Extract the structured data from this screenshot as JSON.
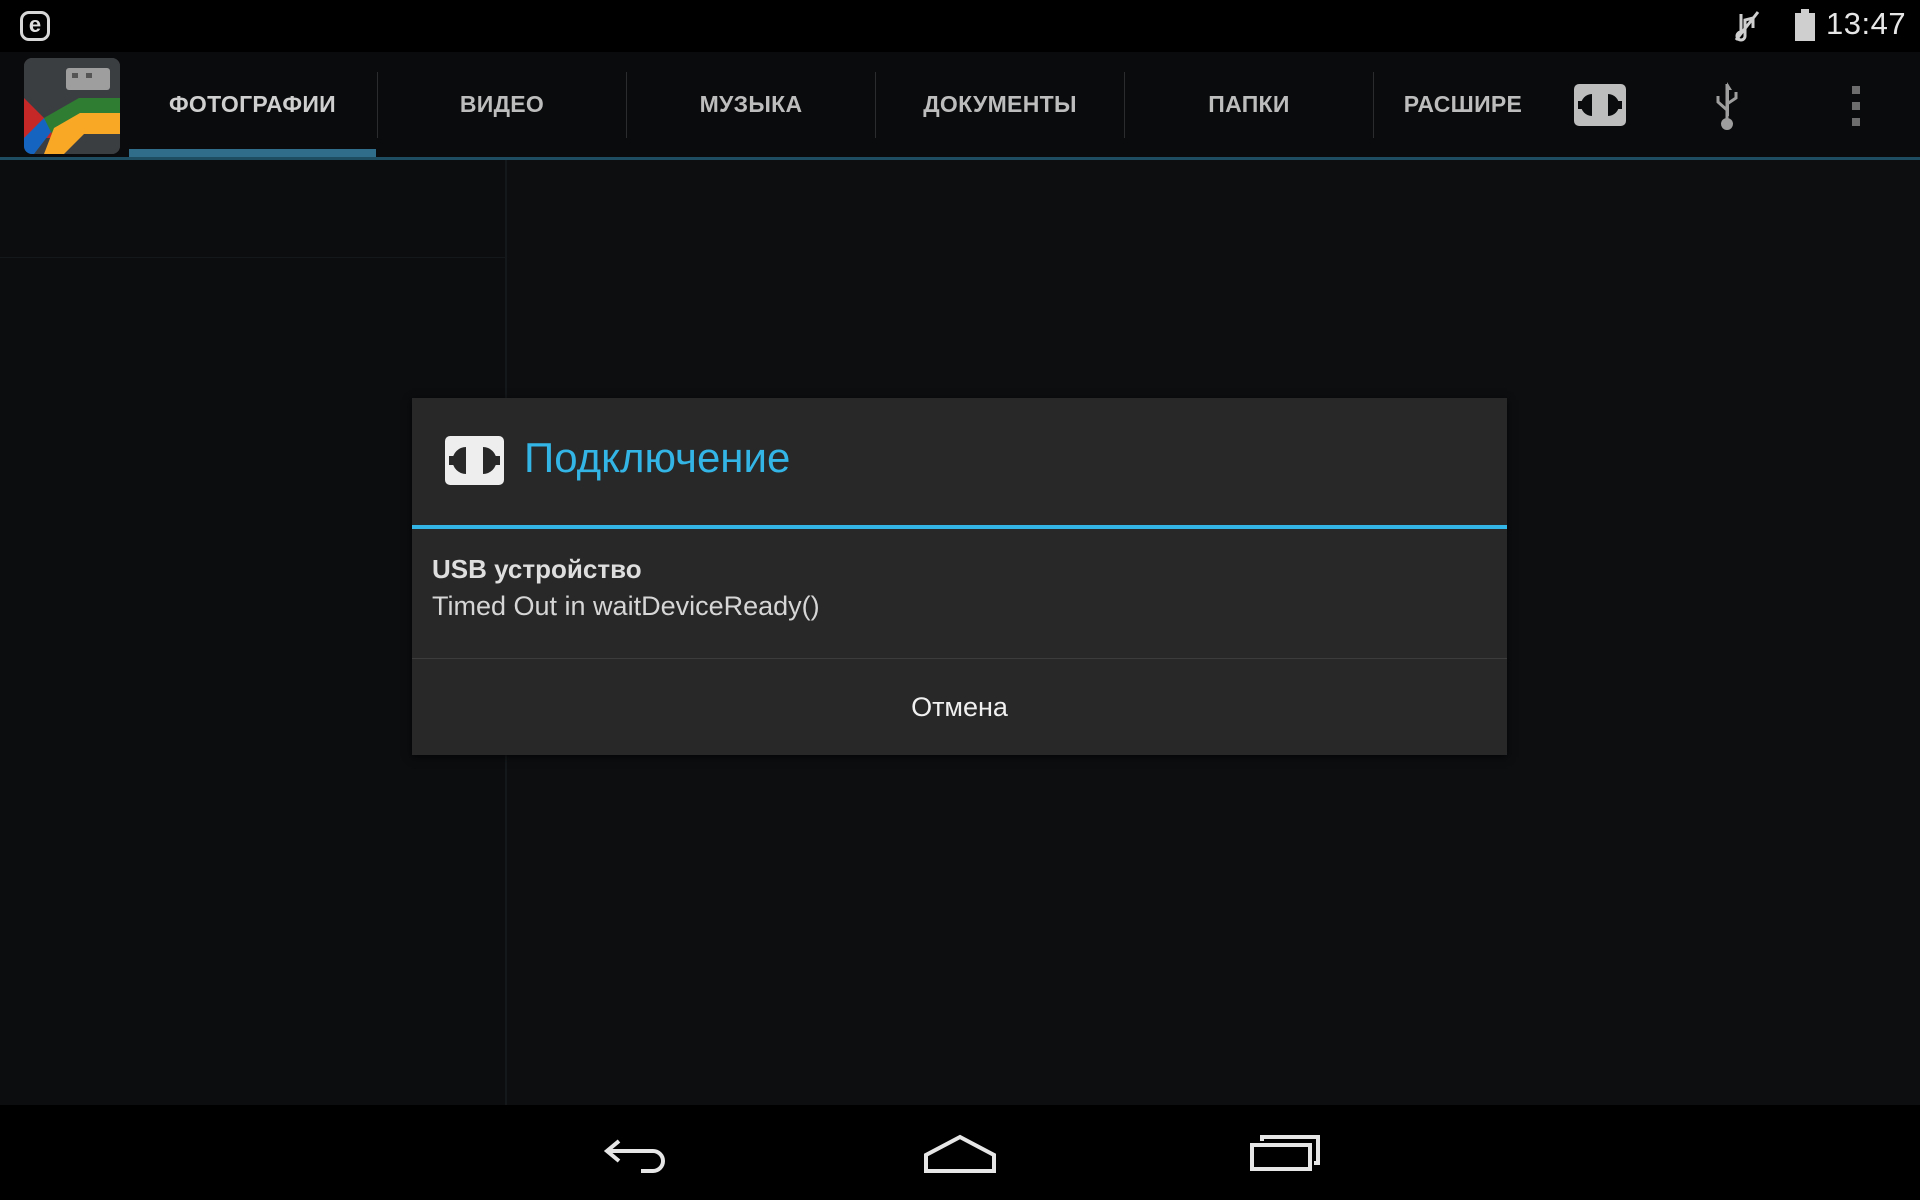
{
  "status_bar": {
    "app_notification_letter": "e",
    "time": "13:47",
    "icons": [
      "app-notification-icon",
      "mute-icon",
      "battery-icon"
    ]
  },
  "action_bar": {
    "tabs": [
      {
        "label": "ФОТОГРАФИИ",
        "selected": true
      },
      {
        "label": "ВИДЕО",
        "selected": false
      },
      {
        "label": "МУЗЫКА",
        "selected": false
      },
      {
        "label": "ДОКУМЕНТЫ",
        "selected": false
      },
      {
        "label": "ПАПКИ",
        "selected": false
      },
      {
        "label": "РАСШИРЕ",
        "selected": false
      }
    ],
    "actions": [
      "connect-icon",
      "usb-icon",
      "overflow-menu-icon"
    ],
    "accent_color": "#2f6d8a"
  },
  "dialog": {
    "title": "Подключение",
    "icon": "connect-icon",
    "message_title": "USB устройство",
    "message": "Timed Out in waitDeviceReady()",
    "cancel_label": "Отмена",
    "accent_color": "#33b5e5"
  },
  "nav_bar": {
    "buttons": [
      "back-icon",
      "home-icon",
      "recent-apps-icon"
    ]
  }
}
